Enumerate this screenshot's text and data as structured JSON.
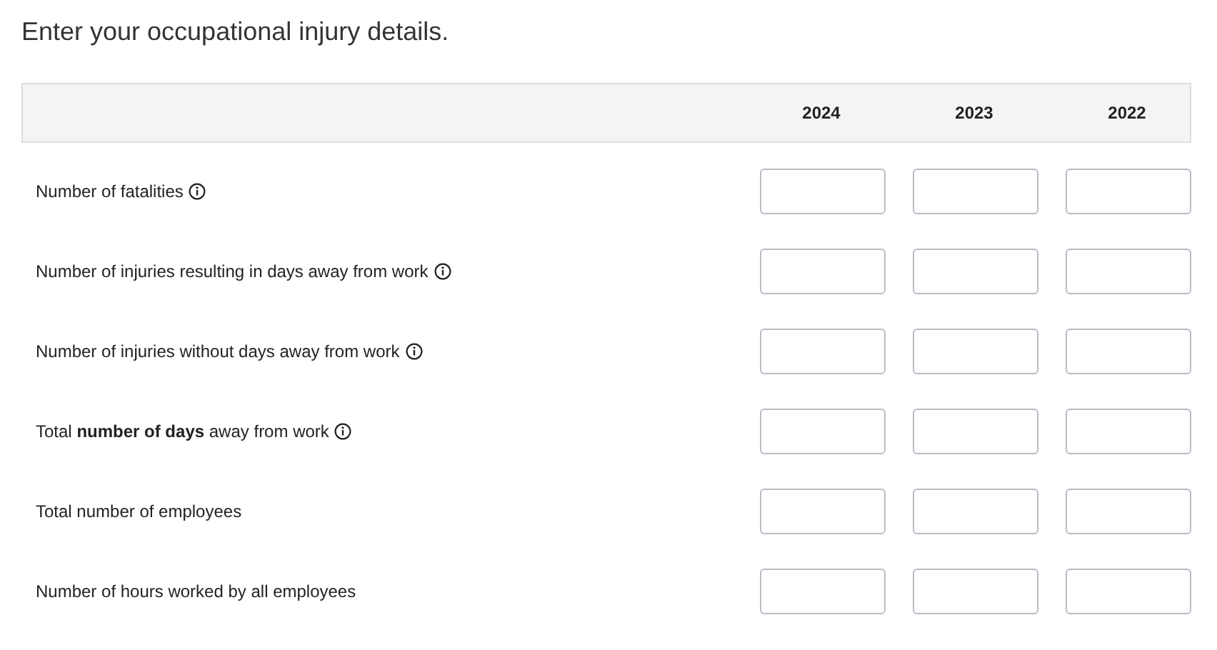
{
  "title": "Enter your occupational injury details.",
  "columns": [
    "2024",
    "2023",
    "2022"
  ],
  "rows": [
    {
      "label": "Number of fatalities",
      "info": true
    },
    {
      "label": "Number of injuries resulting in days away from work",
      "info": true
    },
    {
      "label": "Number of injuries without days away from work",
      "info": true
    },
    {
      "label": "Total **number of days** away from work",
      "info": true
    },
    {
      "label": "Total number of employees",
      "info": false
    },
    {
      "label": "Number of hours worked by all employees",
      "info": false
    }
  ]
}
